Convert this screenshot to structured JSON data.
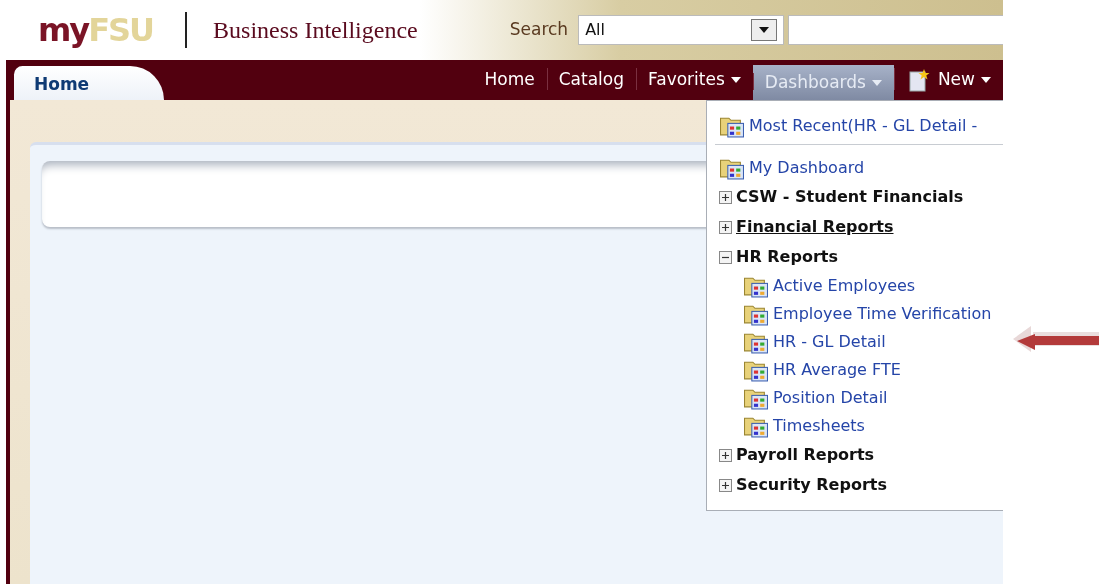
{
  "header": {
    "logo": {
      "part_1": "my",
      "part_2": "FSU"
    },
    "title": "Business Intelligence",
    "search": {
      "label": "Search",
      "scope": "All"
    }
  },
  "tabs": [
    {
      "label": "Home",
      "selected": true
    }
  ],
  "nav": [
    {
      "label": "Home",
      "kind": "link",
      "selected": false
    },
    {
      "label": "Catalog",
      "kind": "link",
      "selected": false
    },
    {
      "label": "Favorites",
      "kind": "menu",
      "selected": false
    },
    {
      "label": "Dashboards",
      "kind": "menu",
      "selected": true
    },
    {
      "label": "New",
      "kind": "new",
      "selected": false
    }
  ],
  "menu": [
    {
      "kind": "recent",
      "label": "Most Recent(HR - GL Detail -"
    },
    {
      "kind": "dashboard",
      "label": "My Dashboard"
    },
    {
      "kind": "group",
      "label": "CSW - Student Financials",
      "expanded": false,
      "hovered": false
    },
    {
      "kind": "group",
      "label": "Financial Reports",
      "expanded": false,
      "hovered": true
    },
    {
      "kind": "group",
      "label": "HR Reports",
      "expanded": true,
      "hovered": false,
      "children": [
        {
          "kind": "dashboard",
          "label": "Active Employees"
        },
        {
          "kind": "dashboard",
          "label": "Employee Time Verification"
        },
        {
          "kind": "dashboard",
          "label": "HR - GL Detail"
        },
        {
          "kind": "dashboard",
          "label": "HR Average FTE"
        },
        {
          "kind": "dashboard",
          "label": "Position Detail"
        },
        {
          "kind": "dashboard",
          "label": "Timesheets"
        }
      ]
    },
    {
      "kind": "group",
      "label": "Payroll Reports",
      "expanded": false,
      "hovered": false
    },
    {
      "kind": "group",
      "label": "Security Reports",
      "expanded": false,
      "hovered": false
    }
  ]
}
